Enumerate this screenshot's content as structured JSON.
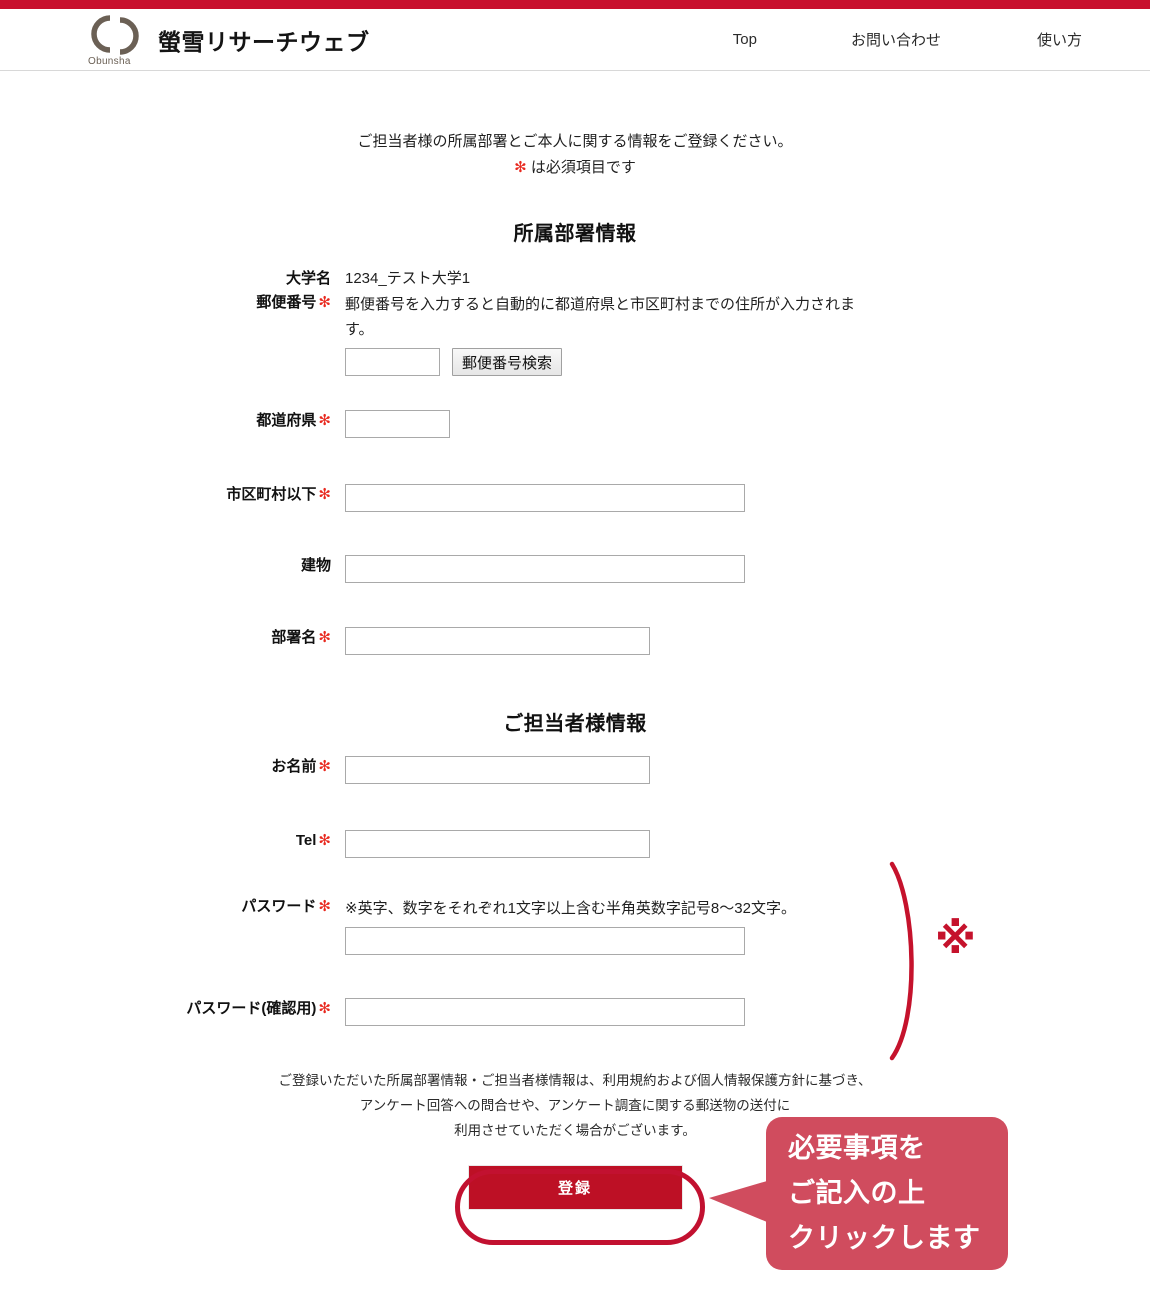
{
  "theme": {
    "brand_red": "#c8102e",
    "button_red": "#bd1025",
    "callout_pink": "#d04c5e",
    "logo_brown": "#6b6055",
    "star_red": "#e8281e"
  },
  "header": {
    "logo_word": "Obunsha",
    "logo_icon": "obunsha-rings-logo",
    "title": "螢雪リサーチウェブ",
    "nav": [
      {
        "label": "Top"
      },
      {
        "label": "お問い合わせ"
      },
      {
        "label": "使い方"
      }
    ]
  },
  "intro": {
    "line1": "ご担当者様の所属部署とご本人に関する情報をご登録ください。",
    "star": "✻",
    "line2": "は必須項目です"
  },
  "sections": {
    "department": {
      "title": "所属部署情報"
    },
    "contact": {
      "title": "ご担当者様情報"
    }
  },
  "fields": {
    "university": {
      "label": "大学名",
      "value": "1234_テスト大学1"
    },
    "zip": {
      "label": "郵便番号",
      "star": "✻",
      "hint": "郵便番号を入力すると自動的に都道府県と市区町村までの住所が入力されます。",
      "value": "",
      "placeholder": "",
      "search_button": "郵便番号検索"
    },
    "prefecture": {
      "label": "都道府県",
      "star": "✻",
      "value": "",
      "placeholder": ""
    },
    "city": {
      "label": "市区町村以下",
      "star": "✻",
      "value": "",
      "placeholder": ""
    },
    "building": {
      "label": "建物",
      "value": "",
      "placeholder": ""
    },
    "department_name": {
      "label": "部署名",
      "star": "✻",
      "value": "",
      "placeholder": ""
    },
    "name": {
      "label": "お名前",
      "star": "✻",
      "value": "",
      "placeholder": ""
    },
    "tel": {
      "label": "Tel",
      "star": "✻",
      "value": "",
      "placeholder": ""
    },
    "password": {
      "label": "パスワード",
      "star": "✻",
      "hint": "※英字、数字をそれぞれ1文字以上含む半角英数字記号8〜32文字。",
      "value": "",
      "placeholder": ""
    },
    "password_confirm": {
      "label": "パスワード(確認用)",
      "star": "✻",
      "value": "",
      "placeholder": ""
    }
  },
  "notice": {
    "line1": "ご登録いただいた所属部署情報・ご担当者様情報は、利用規約および個人情報保護方針に基づき、",
    "line2": "アンケート回答への問合せや、アンケート調査に関する郵送物の送付に",
    "line3": "利用させていただく場合がございます。"
  },
  "submit": {
    "label": "登録"
  },
  "annotations": {
    "brace_symbol": "brace-right",
    "kome_symbol": "※",
    "callout": {
      "line1": "必要事項を",
      "line2": "ご記入の上",
      "line3": "クリックします"
    }
  }
}
